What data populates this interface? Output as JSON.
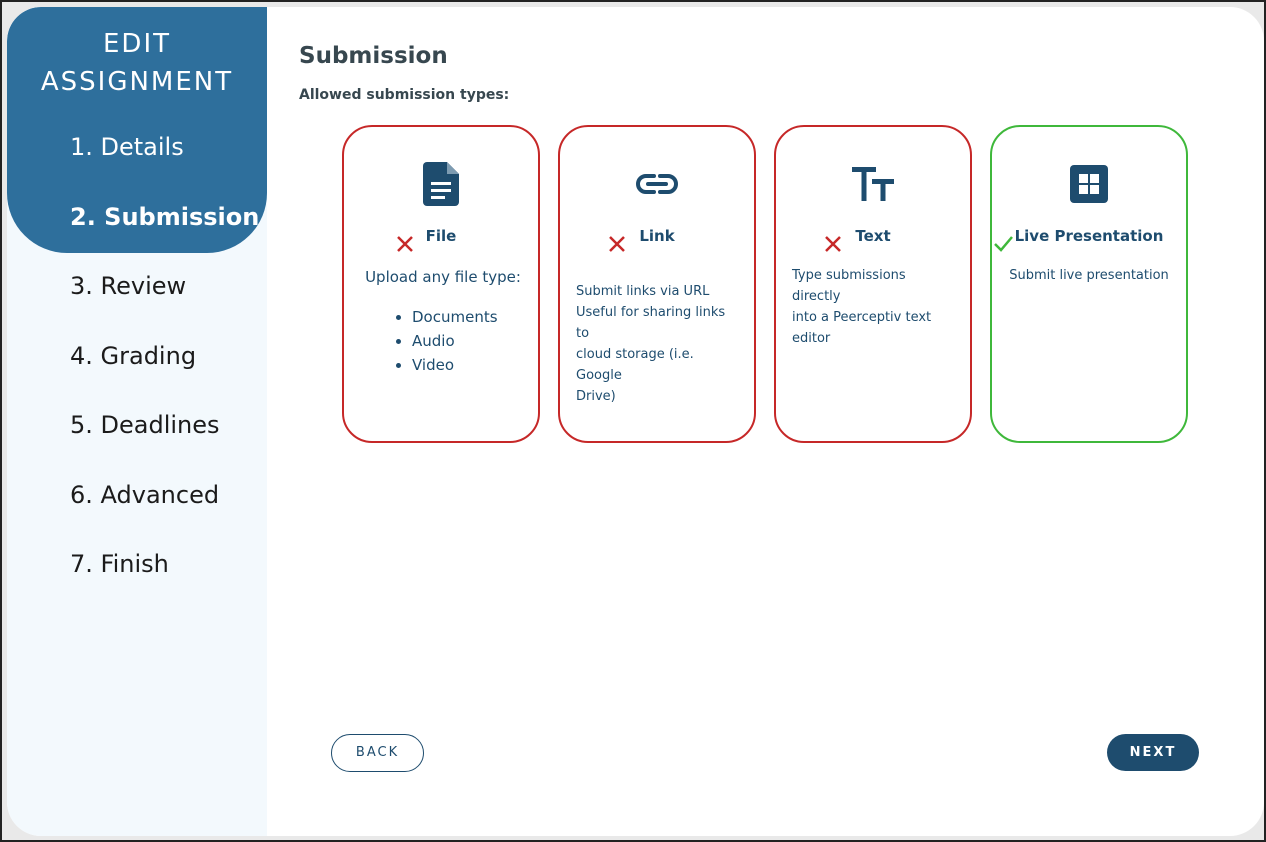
{
  "sidebar": {
    "title_line1": "EDIT",
    "title_line2": "ASSIGNMENT",
    "items": [
      {
        "label": "1. Details"
      },
      {
        "label": "2. Submission"
      },
      {
        "label": "3. Review"
      },
      {
        "label": "4. Grading"
      },
      {
        "label": "5. Deadlines"
      },
      {
        "label": "6. Advanced"
      },
      {
        "label": "7. Finish"
      }
    ],
    "active_index": 1
  },
  "main": {
    "title": "Submission",
    "subhead": "Allowed submission types:",
    "cards": [
      {
        "name": "File",
        "icon": "file-icon",
        "enabled": false,
        "description": "Upload any file type:",
        "list": [
          "Documents",
          "Audio",
          "Video"
        ]
      },
      {
        "name": "Link",
        "icon": "link-icon",
        "enabled": false,
        "description_lines": [
          "Submit links via URL",
          "Useful for sharing links to",
          "cloud storage (i.e. Google",
          "Drive)"
        ]
      },
      {
        "name": "Text",
        "icon": "text-format-icon",
        "enabled": false,
        "description_lines": [
          "Type submissions directly",
          "into a Peerceptiv text",
          "editor"
        ]
      },
      {
        "name": "Live Presentation",
        "icon": "grid-icon",
        "enabled": true,
        "description_lines": [
          "Submit live presentation"
        ]
      }
    ],
    "back_label": "BACK",
    "next_label": "NEXT"
  },
  "colors": {
    "sidebar_active": "#2e6f9c",
    "primary": "#1e4c6e",
    "disabled_border": "#c62828",
    "enabled_border": "#3fb83b"
  }
}
